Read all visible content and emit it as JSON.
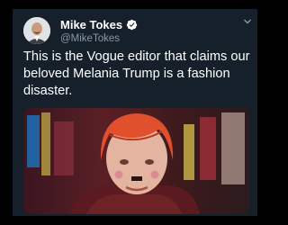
{
  "tweet": {
    "display_name": "Mike Tokes",
    "handle": "@MikeTokes",
    "verified": true,
    "text": "This is the Vogue editor that claims our beloved Melania Trump is a fashion disaster."
  },
  "colors": {
    "background": "#15202b",
    "verified_badge": "#1da1f2",
    "secondary_text": "#8899a6"
  },
  "icons": [
    "verified-badge-icon",
    "chevron-down-icon"
  ]
}
